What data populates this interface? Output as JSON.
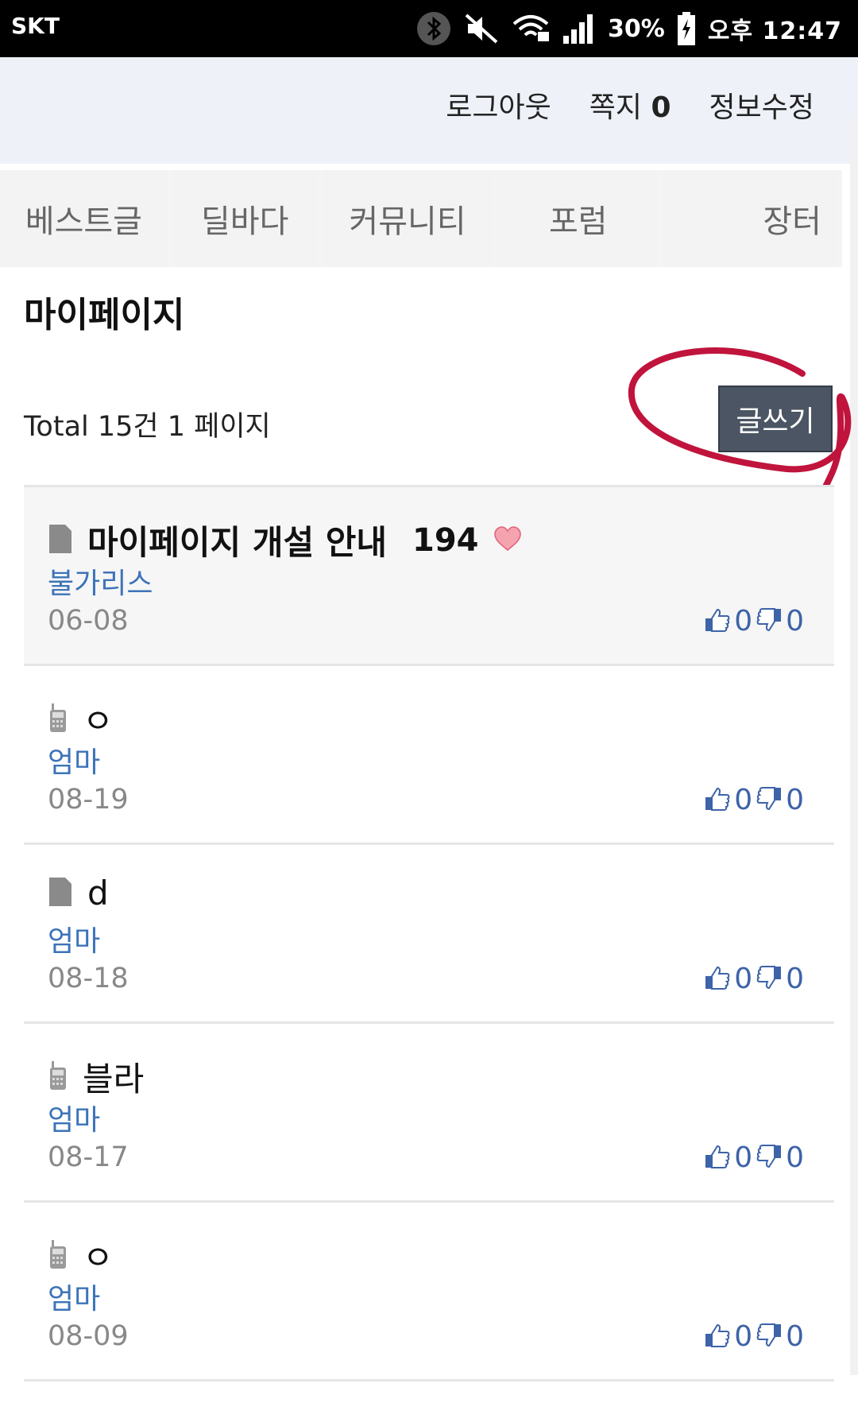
{
  "status_bar": {
    "carrier": "SKT",
    "battery": "30%",
    "time": "오후 12:47",
    "icons": [
      "bluetooth-icon",
      "mute-icon",
      "wifi-icon",
      "signal-icon",
      "battery-icon"
    ]
  },
  "header": {
    "logout": "로그아웃",
    "messages_label": "쪽지",
    "messages_count": "0",
    "edit_profile": "정보수정"
  },
  "nav": {
    "tabs": [
      "베스트글",
      "딜바다",
      "커뮤니티",
      "포럼",
      "장터"
    ]
  },
  "page": {
    "title": "마이페이지",
    "total": "Total 15건 1 페이지",
    "write_button": "글쓰기"
  },
  "colors": {
    "accent_link": "#3d73b8",
    "button_bg": "#4b5563",
    "annotation": "#c0143c"
  },
  "posts": [
    {
      "icon": "document-icon",
      "title": "마이페이지 개설 안내",
      "comments": "194",
      "author": "불가리스",
      "date": "06-08",
      "likes": "0",
      "dislikes": "0",
      "notice": true
    },
    {
      "icon": "mobile-icon",
      "title": "ㅇ",
      "comments": "",
      "author": "엄마",
      "date": "08-19",
      "likes": "0",
      "dislikes": "0"
    },
    {
      "icon": "document-icon",
      "title": "d",
      "comments": "",
      "author": "엄마",
      "date": "08-18",
      "likes": "0",
      "dislikes": "0"
    },
    {
      "icon": "mobile-icon",
      "title": "블라",
      "comments": "",
      "author": "엄마",
      "date": "08-17",
      "likes": "0",
      "dislikes": "0"
    },
    {
      "icon": "mobile-icon",
      "title": "ㅇ",
      "comments": "",
      "author": "엄마",
      "date": "08-09",
      "likes": "0",
      "dislikes": "0"
    }
  ]
}
